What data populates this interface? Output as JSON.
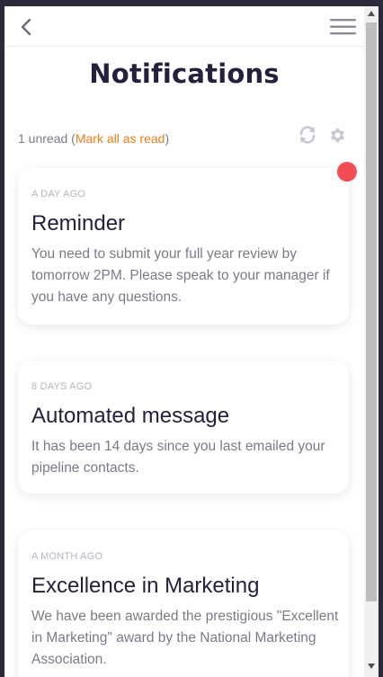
{
  "header": {
    "back_icon": "chevron-left-icon",
    "menu_icon": "hamburger-menu-icon"
  },
  "page_title": "Notifications",
  "status": {
    "unread_count": "1 unread",
    "open_paren": "(",
    "mark_all_label": "Mark all as read",
    "close_paren": ")"
  },
  "toolbar": {
    "refresh_icon": "refresh-icon",
    "settings_icon": "gear-icon"
  },
  "notifications": [
    {
      "ago": "A DAY AGO",
      "title": "Reminder",
      "body": "You need to submit your full year review by tomorrow 2PM. Please speak to your manager if you have any questions.",
      "unread": true
    },
    {
      "ago": "8 DAYS AGO",
      "title": "Automated message",
      "body": "It has been 14 days since you last emailed your pipeline contacts.",
      "unread": false
    },
    {
      "ago": "A MONTH AGO",
      "title": "Excellence in Marketing",
      "body": "We have been awarded the prestigious \"Excellent in Marketing\" award by the National Marketing Association.",
      "unread": false
    }
  ],
  "colors": {
    "accent": "#ef7d18",
    "unread_dot": "#f44c55",
    "title": "#23213b",
    "body_text": "#7b7989"
  }
}
